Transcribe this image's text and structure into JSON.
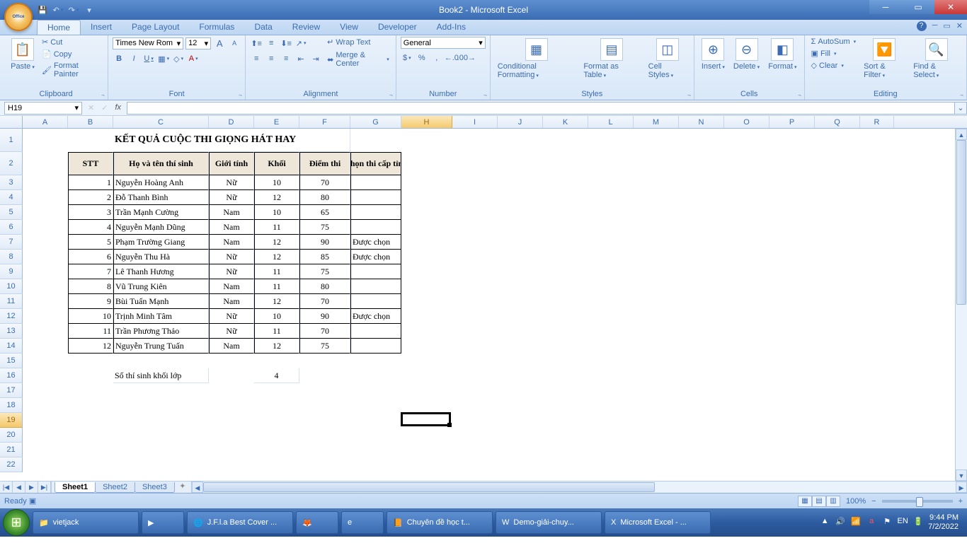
{
  "window": {
    "title": "Book2 - Microsoft Excel"
  },
  "qat": {
    "save": "💾",
    "undo": "↶",
    "redo": "↷",
    "more": "▾"
  },
  "tabs": [
    "Home",
    "Insert",
    "Page Layout",
    "Formulas",
    "Data",
    "Review",
    "View",
    "Developer",
    "Add-Ins"
  ],
  "active_tab": "Home",
  "ribbon": {
    "clipboard": {
      "label": "Clipboard",
      "paste": "Paste",
      "cut": "Cut",
      "copy": "Copy",
      "fmtpaint": "Format Painter"
    },
    "font": {
      "label": "Font",
      "name": "Times New Rom",
      "size": "12",
      "bold": "B",
      "italic": "I",
      "underline": "U",
      "grow": "A",
      "shrink": "A"
    },
    "alignment": {
      "label": "Alignment",
      "wrap": "Wrap Text",
      "merge": "Merge & Center"
    },
    "number": {
      "label": "Number",
      "format": "General",
      "currency": "$",
      "percent": "%",
      "comma": ",",
      "inc": "←.0",
      "dec": ".00→"
    },
    "styles": {
      "label": "Styles",
      "cond": "Conditional Formatting",
      "table": "Format as Table",
      "cellst": "Cell Styles"
    },
    "cells": {
      "label": "Cells",
      "insert": "Insert",
      "delete": "Delete",
      "format": "Format"
    },
    "editing": {
      "label": "Editing",
      "sum": "AutoSum",
      "fill": "Fill",
      "clear": "Clear",
      "sort": "Sort & Filter",
      "find": "Find & Select"
    }
  },
  "namebox": "H19",
  "formula": "",
  "columns": [
    "A",
    "B",
    "C",
    "D",
    "E",
    "F",
    "G",
    "H",
    "I",
    "J",
    "K",
    "L",
    "M",
    "N",
    "O",
    "P",
    "Q",
    "R"
  ],
  "col_widths": {
    "A": 64,
    "B": 64,
    "C": 135,
    "D": 64,
    "E": 64,
    "F": 72,
    "G": 72,
    "H": 72,
    "I": 64,
    "J": 64,
    "K": 64,
    "L": 64,
    "M": 64,
    "N": 64,
    "O": 64,
    "P": 64,
    "Q": 64,
    "R": 48
  },
  "selected_col": "H",
  "selected_row": 19,
  "data_title": "KẾT QUẢ CUỘC THI GIỌNG HÁT HAY",
  "headers": {
    "stt": "STT",
    "name": "Họ và tên thí sinh",
    "gender": "Giới tính",
    "grade": "Khối",
    "score": "Điểm thi",
    "pick": "Chọn thi cấp tỉnh"
  },
  "rows": [
    {
      "stt": 1,
      "name": "Nguyễn Hoàng Anh",
      "gender": "Nữ",
      "grade": 10,
      "score": 70,
      "pick": ""
    },
    {
      "stt": 2,
      "name": "Đỗ Thanh Bình",
      "gender": "Nữ",
      "grade": 12,
      "score": 80,
      "pick": ""
    },
    {
      "stt": 3,
      "name": "Trần Mạnh Cường",
      "gender": "Nam",
      "grade": 10,
      "score": 65,
      "pick": ""
    },
    {
      "stt": 4,
      "name": "Nguyễn Mạnh Dũng",
      "gender": "Nam",
      "grade": 11,
      "score": 75,
      "pick": ""
    },
    {
      "stt": 5,
      "name": "Phạm Trường Giang",
      "gender": "Nam",
      "grade": 12,
      "score": 90,
      "pick": "Được chọn"
    },
    {
      "stt": 6,
      "name": "Nguyễn Thu Hà",
      "gender": "Nữ",
      "grade": 12,
      "score": 85,
      "pick": "Được chọn"
    },
    {
      "stt": 7,
      "name": "Lê Thanh Hương",
      "gender": "Nữ",
      "grade": 11,
      "score": 75,
      "pick": ""
    },
    {
      "stt": 8,
      "name": "Vũ Trung Kiên",
      "gender": "Nam",
      "grade": 11,
      "score": 80,
      "pick": ""
    },
    {
      "stt": 9,
      "name": "Bùi Tuấn Mạnh",
      "gender": "Nam",
      "grade": 12,
      "score": 70,
      "pick": ""
    },
    {
      "stt": 10,
      "name": "Trịnh Minh Tâm",
      "gender": "Nữ",
      "grade": 10,
      "score": 90,
      "pick": "Được chọn"
    },
    {
      "stt": 11,
      "name": "Trần Phương Thảo",
      "gender": "Nữ",
      "grade": 11,
      "score": 70,
      "pick": ""
    },
    {
      "stt": 12,
      "name": "Nguyễn Trung Tuấn",
      "gender": "Nam",
      "grade": 12,
      "score": 75,
      "pick": ""
    }
  ],
  "footer_label": "Số thí sinh khối lớp",
  "footer_value": 4,
  "sheets": [
    "Sheet1",
    "Sheet2",
    "Sheet3"
  ],
  "active_sheet": "Sheet1",
  "status": {
    "ready": "Ready",
    "zoom": "100%"
  },
  "taskbar": {
    "folder": "vietjack",
    "items": [
      "J.F.l.a Best Cover ...",
      "",
      "",
      "Chuyên đề học t...",
      "Demo-giải-chuy...",
      "Microsoft Excel - ..."
    ],
    "time": "9:44 PM",
    "date": "7/2/2022"
  }
}
